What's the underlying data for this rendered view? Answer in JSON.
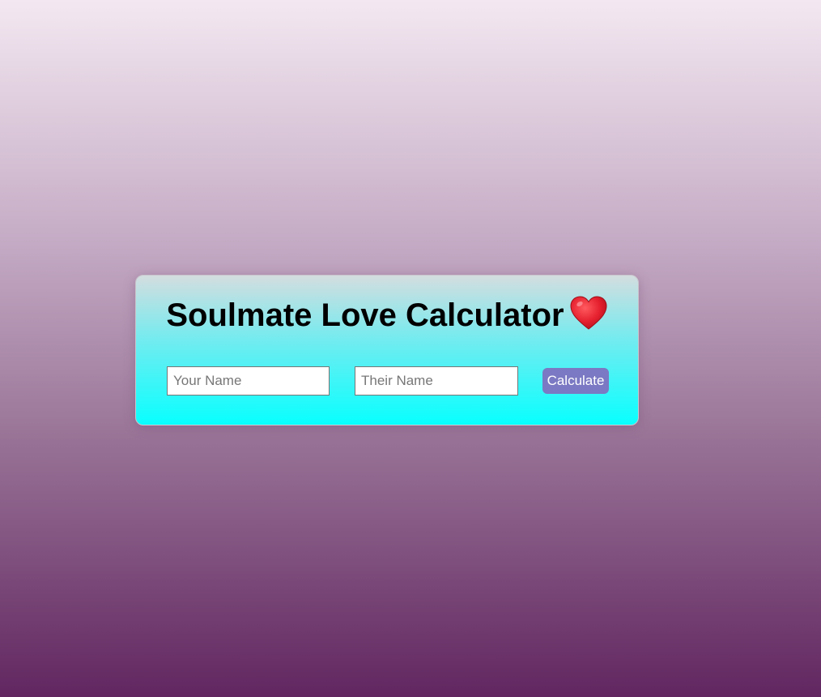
{
  "calculator": {
    "title": "Soulmate Love Calculator",
    "title_icon": "red-heart-icon",
    "your_name": {
      "value": "",
      "placeholder": "Your Name"
    },
    "their_name": {
      "value": "",
      "placeholder": "Their Name"
    },
    "calculate_label": "Calculate"
  },
  "colors": {
    "background_top": "#f3e8f1",
    "background_bottom": "#612660",
    "card_top": "#d4dddf",
    "card_bottom": "#08ffff",
    "button": "#7b79c3",
    "heart": "#e5202e"
  }
}
